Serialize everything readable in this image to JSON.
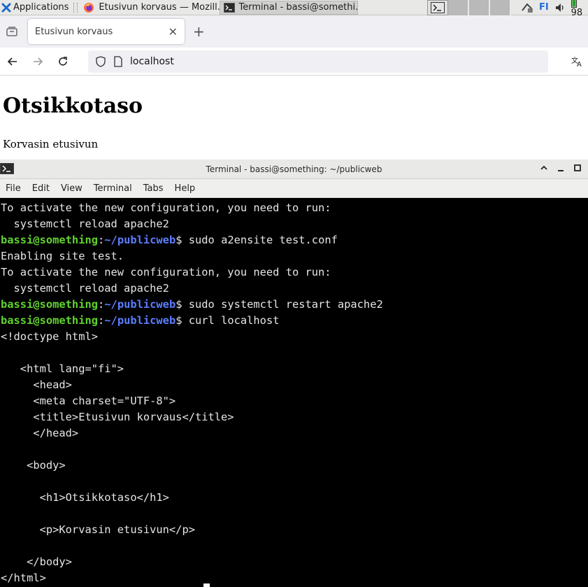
{
  "taskbar": {
    "applications_label": "Applications",
    "firefox_task": "Etusivun korvaus — Mozill...",
    "terminal_task": "Terminal - bassi@somethi...",
    "keyboard_layout": "FI",
    "battery": "98"
  },
  "browser": {
    "tab_title": "Etusivun korvaus",
    "url": "localhost",
    "page_heading": "Otsikkotaso",
    "page_paragraph": "Korvasin etusivun"
  },
  "terminal": {
    "window_title": "Terminal - bassi@something: ~/publicweb",
    "menu": [
      "File",
      "Edit",
      "View",
      "Terminal",
      "Tabs",
      "Help"
    ],
    "prompt_user": "bassi@something",
    "prompt_path": "~/publicweb",
    "lines": [
      {
        "type": "out",
        "text": "To activate the new configuration, you need to run:"
      },
      {
        "type": "out",
        "text": "  systemctl reload apache2"
      },
      {
        "type": "cmd",
        "text": "sudo a2ensite test.conf"
      },
      {
        "type": "out",
        "text": "Enabling site test."
      },
      {
        "type": "out",
        "text": "To activate the new configuration, you need to run:"
      },
      {
        "type": "out",
        "text": "  systemctl reload apache2"
      },
      {
        "type": "cmd",
        "text": "sudo systemctl restart apache2"
      },
      {
        "type": "cmd",
        "text": "curl localhost"
      },
      {
        "type": "out",
        "text": "<!doctype html>"
      },
      {
        "type": "out",
        "text": ""
      },
      {
        "type": "out",
        "text": "   <html lang=\"fi\">"
      },
      {
        "type": "out",
        "text": "     <head>"
      },
      {
        "type": "out",
        "text": "     <meta charset=\"UTF-8\">"
      },
      {
        "type": "out",
        "text": "     <title>Etusivun korvaus</title>"
      },
      {
        "type": "out",
        "text": "     </head>"
      },
      {
        "type": "out",
        "text": ""
      },
      {
        "type": "out",
        "text": "    <body>"
      },
      {
        "type": "out",
        "text": ""
      },
      {
        "type": "out",
        "text": "      <h1>Otsikkotaso</h1>"
      },
      {
        "type": "out",
        "text": ""
      },
      {
        "type": "out",
        "text": "      <p>Korvasin etusivun</p>"
      },
      {
        "type": "out",
        "text": ""
      },
      {
        "type": "out",
        "text": "    </body>"
      },
      {
        "type": "out",
        "text": "</html>"
      }
    ]
  }
}
